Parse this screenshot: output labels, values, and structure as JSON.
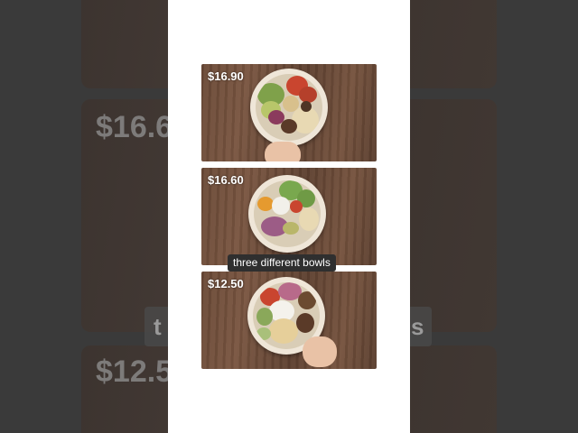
{
  "frames": [
    {
      "price": "$16.90"
    },
    {
      "price": "$16.60"
    },
    {
      "price": "$12.50"
    }
  ],
  "caption": "three different bowls",
  "background": {
    "price_top": "$16.6",
    "price_bottom": "$12.5",
    "caption_left": "t",
    "caption_right": "s"
  },
  "colors": {
    "wood": "#6b4a37",
    "bowl": "#efe6d8",
    "caption_bg": "#2f2f2f"
  }
}
